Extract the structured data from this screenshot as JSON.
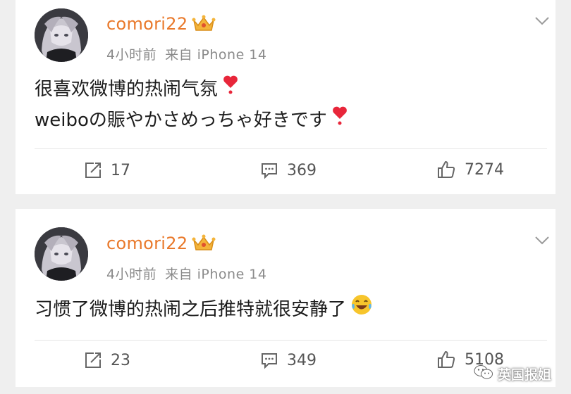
{
  "posts": [
    {
      "username": "comori22",
      "time": "4小时前",
      "source": "来自 iPhone 14",
      "lines": [
        "很喜欢微博的热闹气氛",
        "weiboの賑やかさめっちゃ好きです"
      ],
      "reposts": "17",
      "comments": "369",
      "likes": "7274"
    },
    {
      "username": "comori22",
      "time": "4小时前",
      "source": "来自 iPhone 14",
      "lines": [
        "习惯了微博的热闹之后推特就很安静了"
      ],
      "reposts": "23",
      "comments": "349",
      "likes": "5108"
    }
  ],
  "watermark": "英国报姐",
  "icons": {
    "avatar": "anime-avatar",
    "badge": "crown-icon",
    "menu": "chevron-down-icon",
    "repost": "repost-icon",
    "comment": "comment-icon",
    "like": "thumbs-up-icon",
    "heart_emoji": "heart-emoji-icon",
    "laugh_emoji": "laughing-emoji-icon"
  },
  "colors": {
    "username": "#e9792b",
    "meta": "#8a8a8a",
    "heart": "#e8263a",
    "background": "#efefef"
  }
}
